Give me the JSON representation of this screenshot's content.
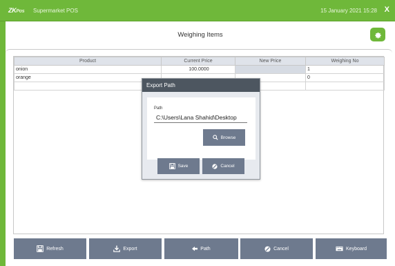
{
  "topbar": {
    "logo_zk": "ZK",
    "logo_pos": "Pos",
    "app_name": "Supermarket POS",
    "datetime": "15 January 2021 15:28",
    "close": "X"
  },
  "header": {
    "title": "Weighing Items"
  },
  "table": {
    "columns": [
      "Product",
      "Current Price",
      "New Price",
      "Weighing No"
    ],
    "rows": [
      {
        "product": "onion",
        "current_price": "100.0000",
        "new_price": "",
        "weighing_no": "1"
      },
      {
        "product": "orange",
        "current_price": "",
        "new_price": "",
        "weighing_no": "0"
      }
    ]
  },
  "dialog": {
    "title": "Export Path",
    "path_label": "Path",
    "path_value": "C:\\Users\\Lana Shahid\\Desktop",
    "browse_label": "Browse",
    "save_label": "Save",
    "cancel_label": "Cancel"
  },
  "toolbar": {
    "refresh_label": "Refresh",
    "export_label": "Export",
    "path_label": "Path",
    "cancel_label": "Cancel",
    "keyboard_label": "Keyboard"
  },
  "colors": {
    "accent": "#6fb83a",
    "button": "#6e7a8e",
    "dialog_title": "#4d5660"
  }
}
